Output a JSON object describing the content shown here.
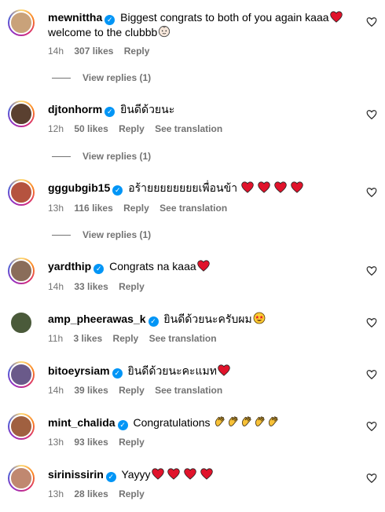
{
  "badge_glyph": "✓",
  "comments": [
    {
      "username": "mewnittha",
      "text": "Biggest congrats to both of you again kaaa",
      "text2": "welcome to the clubbb",
      "time": "14h",
      "likes": "307 likes",
      "reply": "Reply",
      "view_replies": "View replies (1)",
      "avatar_color": "#c9a27a"
    },
    {
      "username": "djtonhorm",
      "text": "ยินดีด้วยนะ",
      "time": "12h",
      "likes": "50 likes",
      "reply": "Reply",
      "see_translation": "See translation",
      "view_replies": "View replies (1)",
      "avatar_color": "#5a4030"
    },
    {
      "username": "gggubgib15",
      "text": "อร้ายยยยยยยยเพื่อนข้า",
      "time": "13h",
      "likes": "116 likes",
      "reply": "Reply",
      "see_translation": "See translation",
      "view_replies": "View replies (1)",
      "avatar_color": "#b5533f"
    },
    {
      "username": "yardthip",
      "text": "Congrats na kaaa",
      "time": "14h",
      "likes": "33 likes",
      "reply": "Reply",
      "avatar_color": "#8a6d5a"
    },
    {
      "username": "amp_pheerawas_k",
      "text": "ยินดีด้วยนะครับผม",
      "time": "11h",
      "likes": "3 likes",
      "reply": "Reply",
      "see_translation": "See translation",
      "avatar_color": "#4a5a3a"
    },
    {
      "username": "bitoeyrsiam",
      "text": "ยินดีด้วยนะคะแมท",
      "time": "14h",
      "likes": "39 likes",
      "reply": "Reply",
      "see_translation": "See translation",
      "avatar_color": "#6a5a8a"
    },
    {
      "username": "mint_chalida",
      "text": "Congratulations",
      "time": "13h",
      "likes": "93 likes",
      "reply": "Reply",
      "avatar_color": "#a06040"
    },
    {
      "username": "sirinissirin",
      "text": "Yayyy",
      "time": "13h",
      "likes": "28 likes",
      "reply": "Reply",
      "avatar_color": "#c08870"
    }
  ],
  "icons": {
    "like": "heart-outline-icon",
    "verified": "verified-badge-icon",
    "red_heart": "red-heart-emoji",
    "clap": "clap-emoji",
    "baby": "baby-emoji",
    "star_eyes": "star-struck-emoji"
  }
}
